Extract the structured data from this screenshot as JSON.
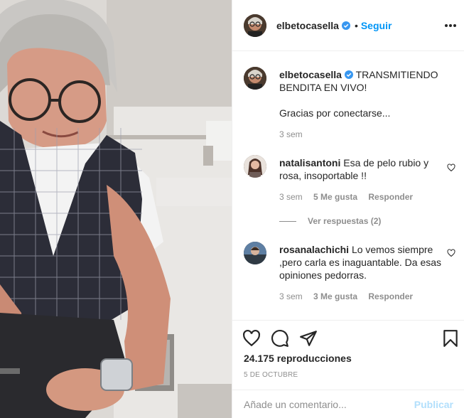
{
  "post": {
    "username": "elbetocasella",
    "follow_label": "Seguir",
    "separator": "•",
    "caption_text": "TRANSMITIENDO BENDITA EN VIVO!",
    "caption_extra": "Gracias por conectarse...",
    "caption_time": "3 sem"
  },
  "comments": [
    {
      "username": "natalisantoni",
      "text": "Esa de pelo rubio y rosa, insoportable !!",
      "time": "3 sem",
      "likes": "5 Me gusta",
      "reply_label": "Responder",
      "view_replies": "Ver respuestas (2)"
    },
    {
      "username": "rosanalachichi",
      "text": "Lo vemos siempre ,pero carla es inaguantable. Da esas opiniones pedorras.",
      "time": "3 sem",
      "likes": "3 Me gusta",
      "reply_label": "Responder"
    }
  ],
  "stats": {
    "views": "24.175 reproducciones",
    "date": "5 DE OCTUBRE"
  },
  "add_comment": {
    "placeholder": "Añade un comentario...",
    "publish_label": "Publicar"
  },
  "colors": {
    "accent": "#0095f6",
    "muted": "#8e8e8e",
    "publish_disabled": "#b2dffc"
  },
  "icons": [
    "more-options-icon",
    "verified-badge-icon",
    "heart-icon",
    "comment-icon",
    "share-icon",
    "bookmark-icon"
  ]
}
